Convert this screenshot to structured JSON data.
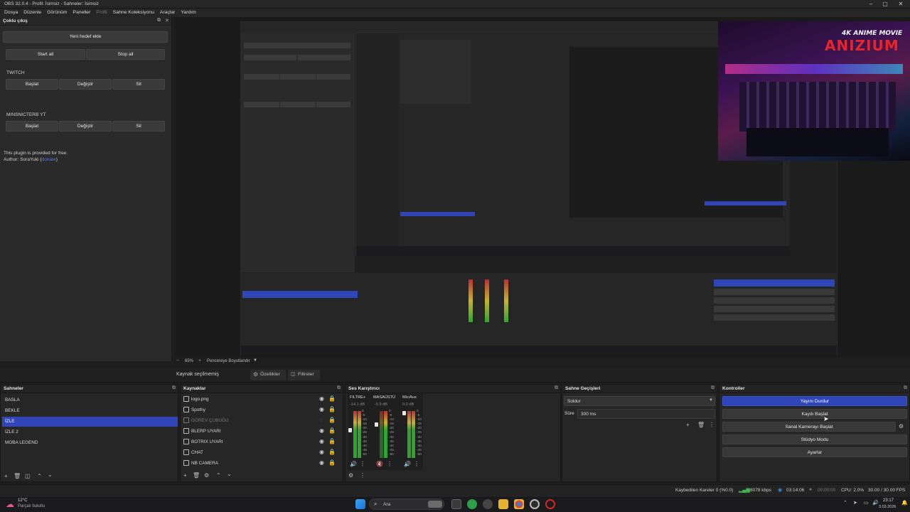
{
  "window": {
    "title": "OBS 32.0.4 - Profil: İsimsiz - Sahneler: İsimsiz"
  },
  "menu": [
    "Dosya",
    "Düzenle",
    "Görünüm",
    "Paneller",
    "Profil",
    "Sahne Koleksiyonu",
    "Araçlar",
    "Yardım"
  ],
  "multi_output": {
    "title": "Çoklu çıkış",
    "add_target": "Yeni hedef ekle",
    "start_all": "Start all",
    "stop_all": "Stop all",
    "targets": [
      {
        "name": "TWITCH",
        "start": "Başlat",
        "edit": "Değiştir",
        "delete": "Sil"
      },
      {
        "name": "MINSNICTERB YT",
        "start": "Başlat",
        "edit": "Değiştir",
        "delete": "Sil"
      }
    ],
    "note_line1": "This plugin is provided for free.",
    "note_line2_prefix": "Author: SoraYuki (",
    "note_link": "donate",
    "note_line2_suffix": ")"
  },
  "banner": {
    "subtitle": "4K ANIME MOVIE",
    "logo": "ANIZIUM"
  },
  "zoom": {
    "value": "65%",
    "mode": "Pencereye Boyutlandır"
  },
  "source_bar": {
    "no_source": "Kaynak seçilmemiş",
    "properties": "Özellikler",
    "filters": "Filtreler"
  },
  "scenes": {
    "title": "Sahneler",
    "items": [
      "BASLA",
      "BEKLE",
      "İZLE",
      "İZLE 2",
      "MOBA LEGEND"
    ],
    "selected": 2
  },
  "sources": {
    "title": "Kaynaklar",
    "items": [
      {
        "name": "logo.png",
        "hidden": false
      },
      {
        "name": "Spothy",
        "hidden": false
      },
      {
        "name": "GÖREV ÇUBUĞU",
        "hidden": true
      },
      {
        "name": "BLERP UYARI",
        "hidden": false
      },
      {
        "name": "BOTRIX UYARI",
        "hidden": false
      },
      {
        "name": "CHAT",
        "hidden": false
      },
      {
        "name": "NB CAMERA",
        "hidden": false
      }
    ]
  },
  "mixer": {
    "title": "Ses Karıştırıcı",
    "channels": [
      {
        "name": "FILTRE+",
        "db": "-14.1 dB"
      },
      {
        "name": "MASAÜSTÜ",
        "db": "-5.9 dB"
      },
      {
        "name": "Mic/Aux",
        "db": "0.0 dB"
      }
    ],
    "scale": [
      "0",
      "-5",
      "-10",
      "-15",
      "-20",
      "-25",
      "-30",
      "-35",
      "-40",
      "-45",
      "-50",
      "-55",
      "-60"
    ]
  },
  "transitions": {
    "title": "Sahne Geçişleri",
    "type": "Soldur",
    "duration_label": "Süre",
    "duration_value": "300 ms"
  },
  "controls": {
    "title": "Kontroller",
    "stop_stream": "Yayını Durdur",
    "start_recording": "Kaydı Başlat",
    "virtual_cam": "Sanal Kamerayı Başlat",
    "studio_mode": "Stüdyo Modu",
    "settings": "Ayarlar"
  },
  "status": {
    "dropped": "Kaybedilen Kareler 0 (%0.0)",
    "bitrate": "8078 kbps",
    "stream_time": "03:14:06",
    "rec_time": "00:00:00",
    "cpu": "CPU: 2.0%",
    "fps": "30.00 / 30.00 FPS"
  },
  "taskbar": {
    "weather_temp": "12°C",
    "weather_desc": "Parçalı bulutlu",
    "search": "Ara",
    "time": "23:17",
    "date": "3.03.2026"
  },
  "colors": {
    "accent": "#2f45b8",
    "background": "#1e1e1e",
    "panel": "#262626"
  }
}
